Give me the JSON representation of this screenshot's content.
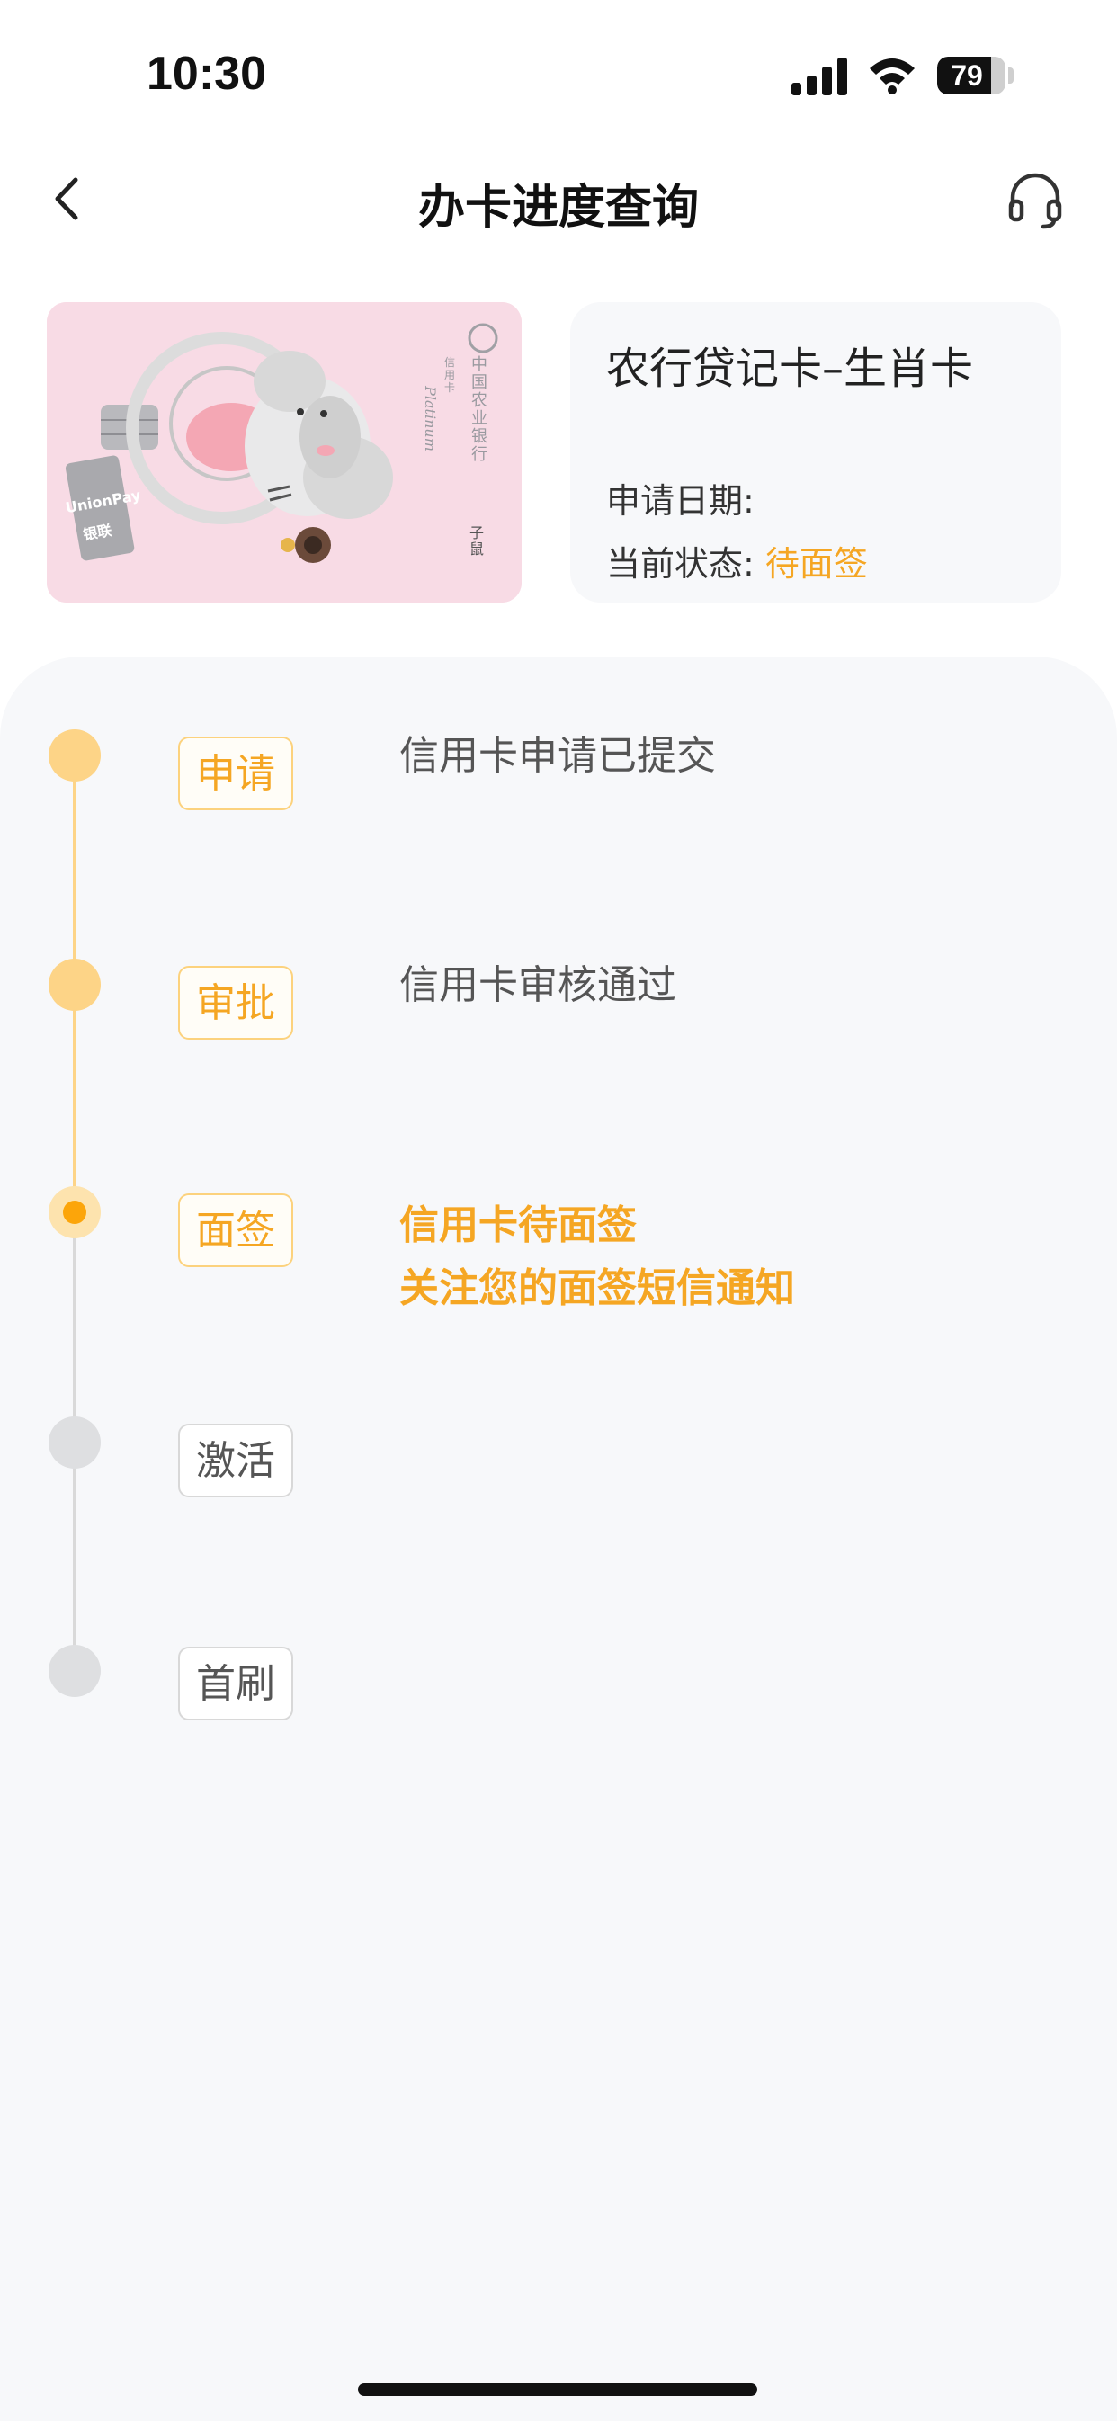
{
  "status_bar": {
    "time": "10:30",
    "battery_text": "79",
    "battery_level": 0.79,
    "icons": [
      "cellular-signal-icon",
      "wifi-icon",
      "battery-icon"
    ]
  },
  "nav": {
    "title": "办卡进度查询",
    "back_icon": "chevron-left-icon",
    "service_icon": "headset-icon"
  },
  "card": {
    "name": "农行贷记卡–生肖卡",
    "apply_date_label": "申请日期:",
    "status_label": "当前状态:",
    "status_value": "待面签",
    "image_texts": {
      "bank_name": "中国农业银行",
      "card_type": "信用卡",
      "card_level": "Platinum",
      "zodiac": "子鼠",
      "network_cn": "银联",
      "network_en": "UnionPay"
    }
  },
  "steps": [
    {
      "tag": "申请",
      "state": "done",
      "lines": [
        "信用卡申请已提交"
      ]
    },
    {
      "tag": "审批",
      "state": "done",
      "lines": [
        "信用卡审核通过"
      ]
    },
    {
      "tag": "面签",
      "state": "current",
      "lines": [
        "信用卡待面签",
        "关注您的面签短信通知"
      ]
    },
    {
      "tag": "激活",
      "state": "pending",
      "lines": []
    },
    {
      "tag": "首刷",
      "state": "pending",
      "lines": []
    }
  ],
  "colors": {
    "accent": "#f5a623",
    "dot_done": "#fdd487",
    "dot_pending": "#dedfe1",
    "line_done": "#fdd487",
    "line_pending": "#d9d9d9",
    "panel_bg": "#f7f8fa",
    "card_bg": "#f8dbe5"
  }
}
